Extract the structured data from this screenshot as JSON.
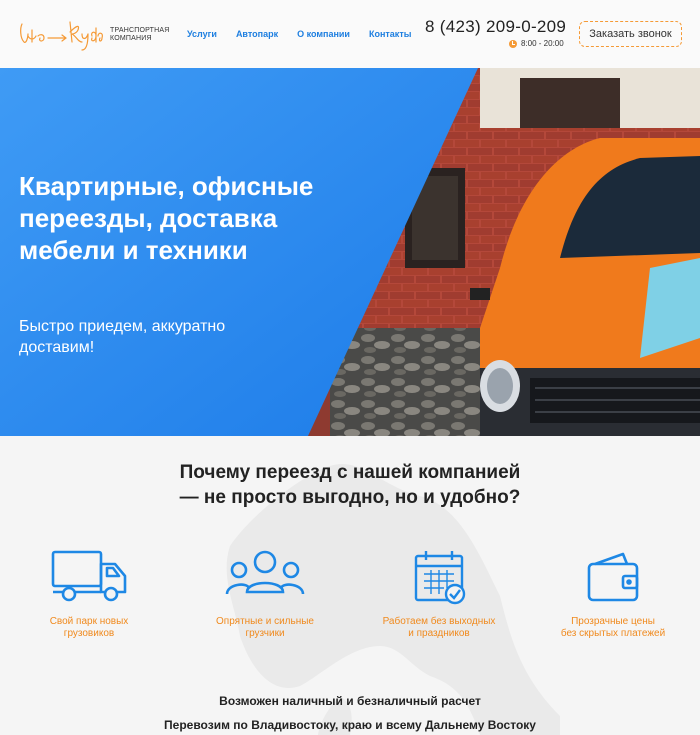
{
  "header": {
    "logo_text": "Что-Куда",
    "logo_subtitle_line1": "ТРАНСПОРТНАЯ",
    "logo_subtitle_line2": "КОМПАНИЯ",
    "nav": [
      {
        "label": "Услуги"
      },
      {
        "label": "Автопарк"
      },
      {
        "label": "О компании"
      },
      {
        "label": "Контакты"
      }
    ],
    "phone": "8 (423) 209-0-209",
    "hours": "8:00 - 20:00",
    "call_button": "Заказать звонок"
  },
  "hero": {
    "title": "Квартирные, офисные переезды, доставка мебели и техники",
    "subtitle": "Быстро приедем, аккуратно доставим!"
  },
  "benefits": {
    "title_line1": "Почему переезд с нашей компанией",
    "title_line2": "— не просто выгодно, но и удобно?",
    "items": [
      {
        "icon": "truck-icon",
        "line1": "Свой парк новых",
        "line2": "грузовиков"
      },
      {
        "icon": "team-icon",
        "line1": "Опрятные и сильные",
        "line2": "грузчики"
      },
      {
        "icon": "calendar-icon",
        "line1": "Работаем без выходных",
        "line2": "и праздников"
      },
      {
        "icon": "wallet-icon",
        "line1": "Прозрачные цены",
        "line2": "без скрытых платежей"
      }
    ],
    "info_line1": "Возможен наличный и безналичный расчет",
    "info_line2": "Перевозим по Владивостоку, краю и всему Дальнему Востоку"
  },
  "colors": {
    "accent_blue": "#1e88e5",
    "accent_orange": "#f59a36",
    "hero_blue": "#2f8ef0"
  }
}
